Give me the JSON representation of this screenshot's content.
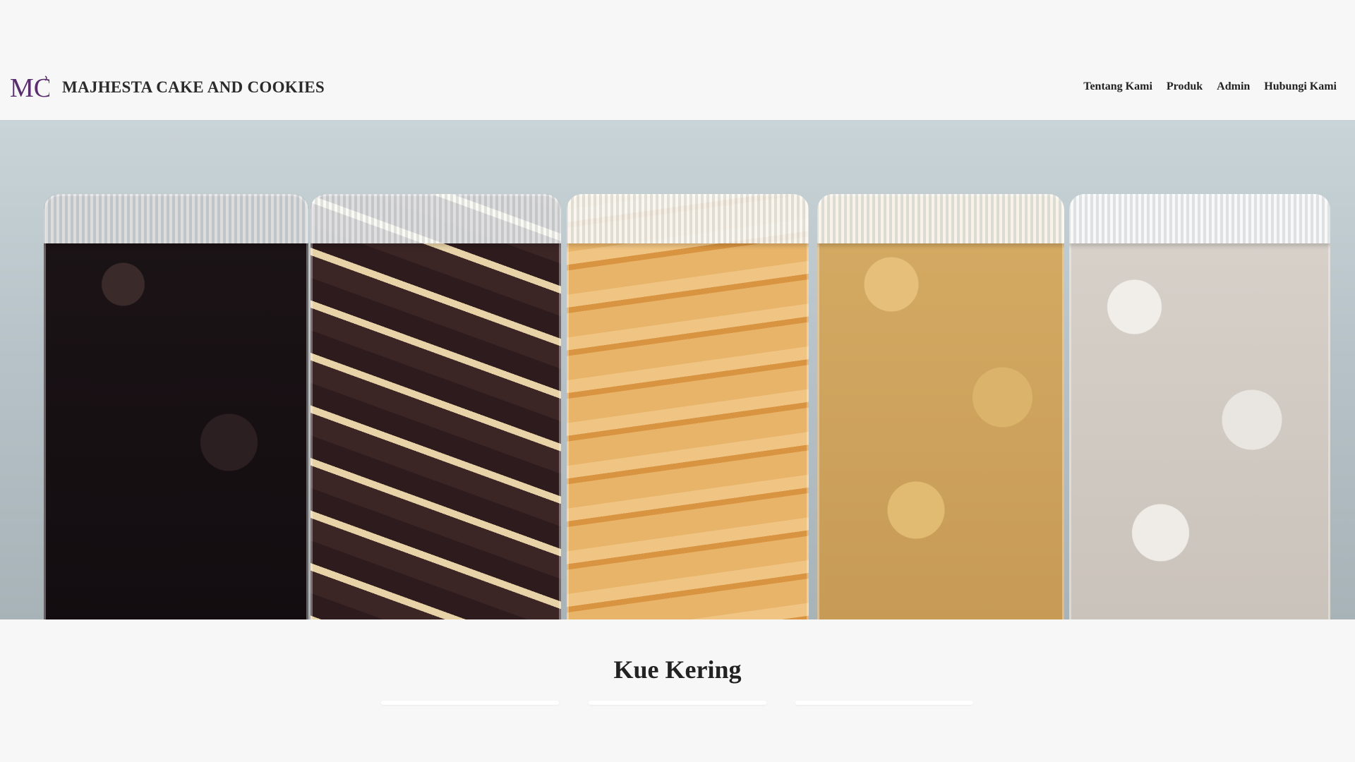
{
  "header": {
    "logo_text": "MC",
    "brand_name": "MAJHESTA CAKE AND COOKIES",
    "nav": [
      {
        "label": "Tentang Kami"
      },
      {
        "label": "Produk"
      },
      {
        "label": "Admin"
      },
      {
        "label": "Hubungi Kami"
      }
    ]
  },
  "hero": {
    "image_subject": "cookie-jars",
    "jar_count": 5
  },
  "section": {
    "title": "Kue Kering",
    "card_count": 3
  },
  "colors": {
    "logo_purple": "#5a2d6e",
    "background": "#f7f7f7",
    "text": "#222222"
  }
}
